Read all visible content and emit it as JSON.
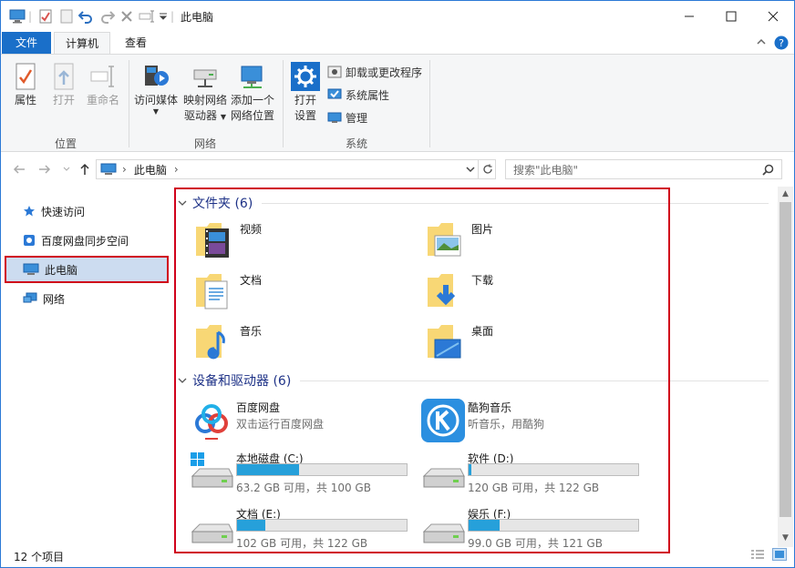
{
  "window": {
    "title": "此电脑"
  },
  "tabs": {
    "file": "文件",
    "computer": "计算机",
    "view": "查看"
  },
  "ribbon": {
    "location": {
      "label": "位置",
      "properties": "属性",
      "open": "打开",
      "rename": "重命名"
    },
    "network": {
      "label": "网络",
      "access_media_1": "访问媒体",
      "map_drive_1": "映射网络",
      "map_drive_2": "驱动器",
      "add_location_1": "添加一个",
      "add_location_2": "网络位置"
    },
    "system": {
      "label": "系统",
      "open_settings_1": "打开",
      "open_settings_2": "设置",
      "uninstall": "卸载或更改程序",
      "system_properties": "系统属性",
      "manage": "管理"
    }
  },
  "address": {
    "path": "此电脑",
    "search_placeholder": "搜索\"此电脑\""
  },
  "nav": [
    {
      "label": "快速访问",
      "icon": "star-icon"
    },
    {
      "label": "百度网盘同步空间",
      "icon": "baidu-sync-icon"
    },
    {
      "label": "此电脑",
      "icon": "computer-icon",
      "selected": true
    },
    {
      "label": "网络",
      "icon": "network-icon"
    }
  ],
  "folders": {
    "header": "文件夹 (6)",
    "items": [
      {
        "name": "视频",
        "icon": "videos-folder-icon"
      },
      {
        "name": "图片",
        "icon": "pictures-folder-icon"
      },
      {
        "name": "文档",
        "icon": "documents-folder-icon"
      },
      {
        "name": "下载",
        "icon": "downloads-folder-icon"
      },
      {
        "name": "音乐",
        "icon": "music-folder-icon"
      },
      {
        "name": "桌面",
        "icon": "desktop-folder-icon"
      }
    ]
  },
  "devices": {
    "header": "设备和驱动器 (6)",
    "apps": [
      {
        "name": "百度网盘",
        "sub": "双击运行百度网盘",
        "icon": "baidu-netdisk-icon"
      },
      {
        "name": "酷狗音乐",
        "sub": "听音乐，用酷狗",
        "icon": "kugou-icon"
      }
    ],
    "drives": [
      {
        "name": "本地磁盘 (C:)",
        "free": "63.2 GB 可用，共 100 GB",
        "used_fraction": 0.368,
        "icon": "windows-drive-icon"
      },
      {
        "name": "软件 (D:)",
        "free": "120 GB 可用，共 122 GB",
        "used_fraction": 0.016,
        "icon": "drive-icon"
      },
      {
        "name": "文档 (E:)",
        "free": "102 GB 可用，共 122 GB",
        "used_fraction": 0.164,
        "icon": "drive-icon"
      },
      {
        "name": "娱乐 (F:)",
        "free": "99.0 GB 可用，共 121 GB",
        "used_fraction": 0.182,
        "icon": "drive-icon"
      }
    ]
  },
  "status": {
    "count": "12 个项目"
  },
  "colors": {
    "accent": "#1a6fc9",
    "highlight": "#d0021b",
    "group_header": "#1e3287",
    "bar_fill": "#26a0da"
  }
}
